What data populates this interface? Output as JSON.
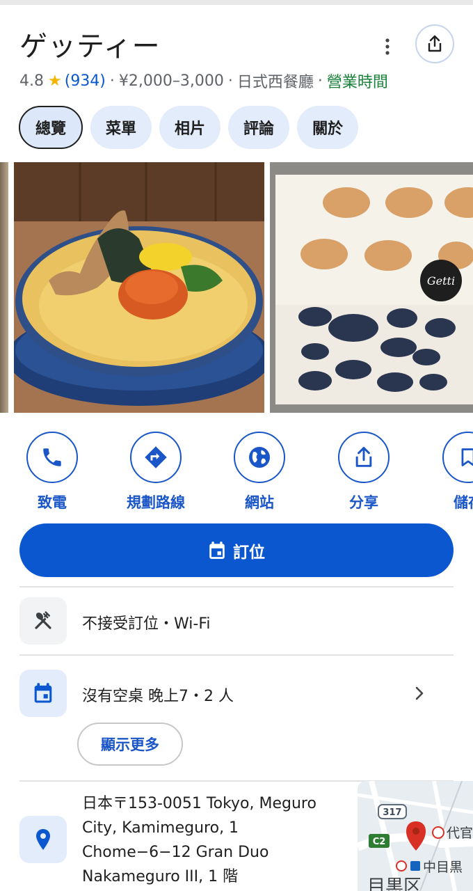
{
  "place": {
    "name": "ゲッティー",
    "rating": "4.8",
    "review_count": "(934)",
    "price": "¥2,000–3,000",
    "category": "日式西餐廳",
    "hours": "營業時間"
  },
  "tabs": [
    {
      "label": "總覽",
      "active": true
    },
    {
      "label": "菜單"
    },
    {
      "label": "相片"
    },
    {
      "label": "評論"
    },
    {
      "label": "關於"
    }
  ],
  "actions": [
    {
      "label": "致電",
      "icon": "phone-icon"
    },
    {
      "label": "規劃路線",
      "icon": "directions-icon"
    },
    {
      "label": "網站",
      "icon": "globe-icon"
    },
    {
      "label": "分享",
      "icon": "share-icon"
    },
    {
      "label": "儲存",
      "icon": "bookmark-icon"
    }
  ],
  "reserve_button": "訂位",
  "amenities": "不接受訂位・Wi-Fi",
  "availability": "沒有空桌 晚上7・2 人",
  "show_more": "顯示更多",
  "address": "日本〒153-0051 Tokyo, Meguro City, Kamimeguro, 1 Chome−6−12 Gran Duo Nakameguro III, 1 階",
  "map": {
    "route_badge_1": "317",
    "route_badge_2": "C2",
    "station_label": "中目黒",
    "area_label": "目黒区",
    "top_label": "代官"
  },
  "menu_photo": {
    "logo_text": "Getti"
  },
  "colors": {
    "accent": "#0b57d0",
    "open_green": "#188038",
    "star": "#f4b400",
    "chip_bg": "#e3ecfb"
  }
}
